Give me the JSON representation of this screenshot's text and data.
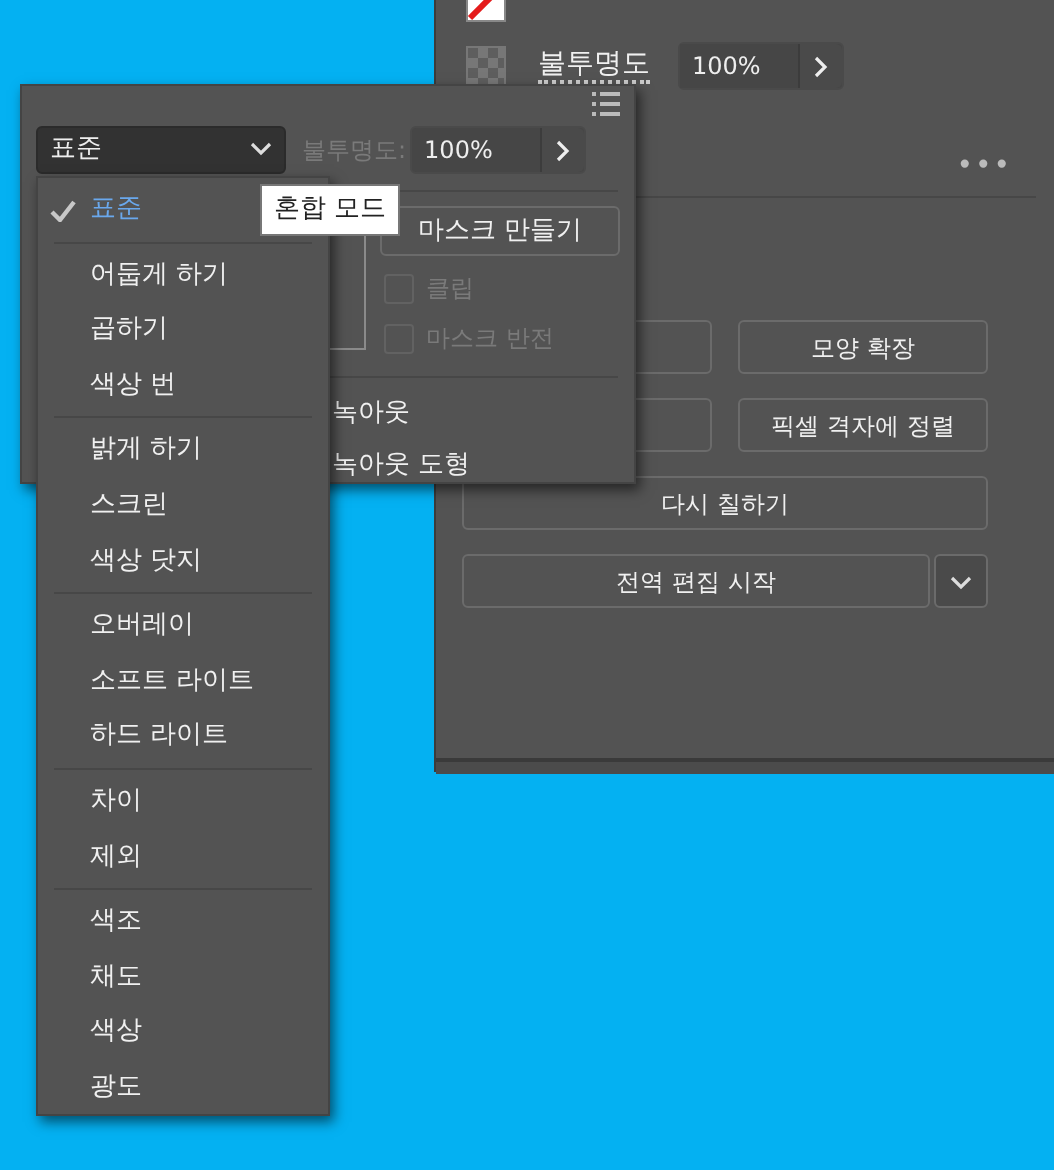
{
  "back_panel": {
    "opacity_label": "불투명도",
    "opacity_value": "100%",
    "more": "•••",
    "button_rows": [
      {
        "kind": "pair",
        "right": "모양 확장"
      },
      {
        "kind": "pair",
        "right": "픽셀 격자에 정렬"
      },
      {
        "kind": "wide",
        "label": "다시 칠하기"
      },
      {
        "kind": "split",
        "label": "전역 편집 시작"
      }
    ]
  },
  "transparency_panel": {
    "blend_mode": "표준",
    "opacity_label": "불투명도:",
    "opacity_value": "100%",
    "mask_button": "마스크 만들기",
    "checkboxes": [
      {
        "label": "클립",
        "checked": false,
        "disabled": true
      },
      {
        "label": "마스크 반전",
        "checked": false,
        "disabled": true
      }
    ],
    "options": [
      "녹아웃",
      "녹아웃 도형"
    ]
  },
  "tooltip": "혼합 모드",
  "blend_menu": [
    [
      {
        "label": "표준",
        "selected": true
      }
    ],
    [
      {
        "label": "어둡게 하기",
        "selected": false
      },
      {
        "label": "곱하기",
        "selected": false
      },
      {
        "label": "색상 번",
        "selected": false
      }
    ],
    [
      {
        "label": "밝게 하기",
        "selected": false
      },
      {
        "label": "스크린",
        "selected": false
      },
      {
        "label": "색상 닷지",
        "selected": false
      }
    ],
    [
      {
        "label": "오버레이",
        "selected": false
      },
      {
        "label": "소프트 라이트",
        "selected": false
      },
      {
        "label": "하드 라이트",
        "selected": false
      }
    ],
    [
      {
        "label": "차이",
        "selected": false
      },
      {
        "label": "제외",
        "selected": false
      }
    ],
    [
      {
        "label": "색조",
        "selected": false
      },
      {
        "label": "채도",
        "selected": false
      },
      {
        "label": "색상",
        "selected": false
      },
      {
        "label": "광도",
        "selected": false
      }
    ]
  ]
}
